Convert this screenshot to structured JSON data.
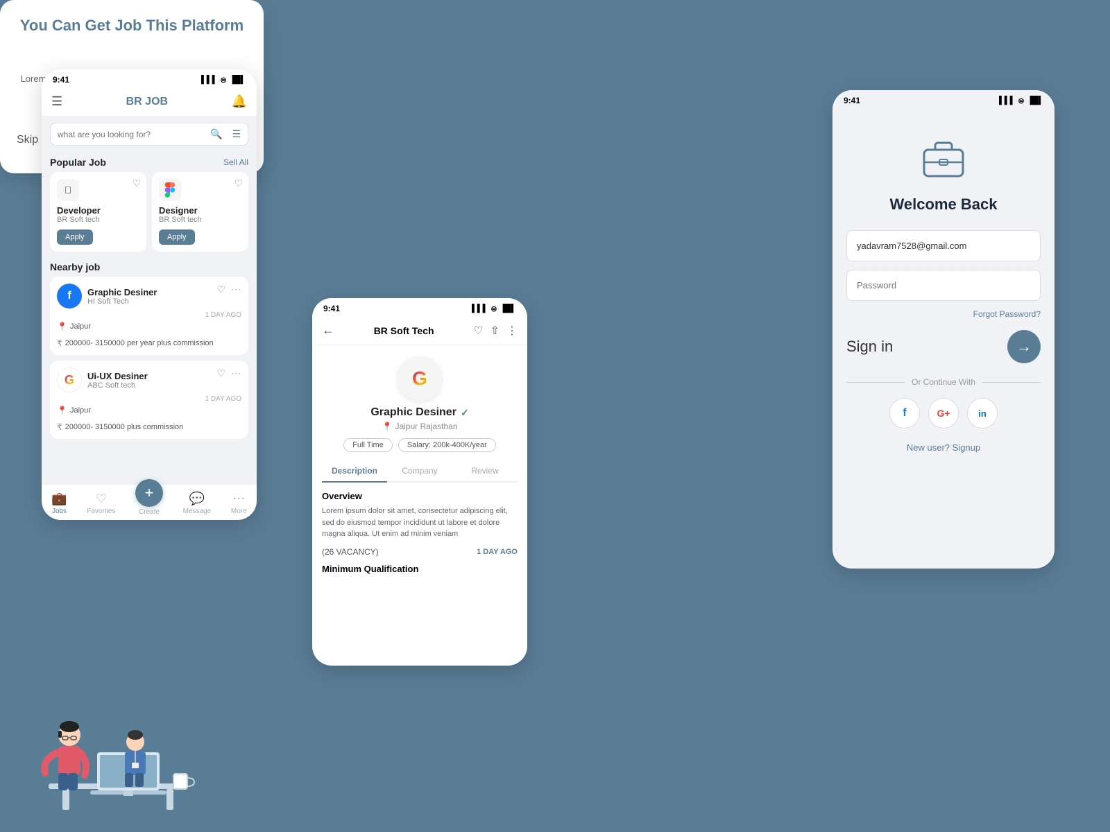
{
  "background": "#5a7d96",
  "phone_joblist": {
    "status_time": "9:41",
    "app_name": "BR JOB",
    "search_placeholder": "what are you looking for?",
    "popular_job_title": "Popular Job",
    "sell_all": "Sell All",
    "jobs": [
      {
        "title": "Developer",
        "company": "BR Soft tech",
        "logo_type": "apple",
        "apply_label": "Apply"
      },
      {
        "title": "Designer",
        "company": "BR Soft tech",
        "logo_type": "figma",
        "apply_label": "Apply"
      }
    ],
    "nearby_title": "Nearby job",
    "nearby_jobs": [
      {
        "title": "Graphic Desiner",
        "company": "HI Soft Tech",
        "logo_type": "facebook",
        "time_ago": "1 DAY AGO",
        "location": "Jaipur",
        "salary": "200000- 3150000 per year plus commission"
      },
      {
        "title": "Ui-UX Desiner",
        "company": "ABC Soft tech",
        "logo_type": "google",
        "time_ago": "1 DAY AGO",
        "location": "Jaipur",
        "salary": "200000- 3150000 plus commission"
      }
    ],
    "nav": {
      "jobs": "Jobs",
      "favorites": "Favorites",
      "create": "Create",
      "message": "Message",
      "more": "More"
    }
  },
  "onboarding": {
    "title": "You Can Get Job This Platform",
    "description": "Lorem ipsum dolor sit amet, consectetur adipiscing sed.",
    "skip": "Skip"
  },
  "phone_detail": {
    "status_time": "9:41",
    "company_name": "BR Soft Tech",
    "job_title": "Graphic Desiner",
    "location": "Jaipur Rajasthan",
    "full_time": "Full Time",
    "salary": "Salary: 200k-400K/year",
    "tabs": [
      "Description",
      "Company",
      "Review"
    ],
    "active_tab": "Description",
    "overview_title": "Overview",
    "overview_text": "Lorem ipsum dolor sit amet, consectetur adipiscing elit, sed do eiusmod tempor incididunt ut labore et dolore magna aliqua. Ut enim ad minim veniam",
    "vacancy": "(26 VACANCY)",
    "time_ago": "1 DAY AGO",
    "min_qual": "Minimum Qualification"
  },
  "phone_login": {
    "status_time": "9:41",
    "welcome_title": "Welcome Back",
    "email_value": "yadavram7528@gmail.com",
    "password_placeholder": "Password",
    "forgot_password": "Forgot Password?",
    "sign_in_label": "Sign in",
    "or_continue": "Or Continue With",
    "new_user_label": "New user? Signup"
  }
}
